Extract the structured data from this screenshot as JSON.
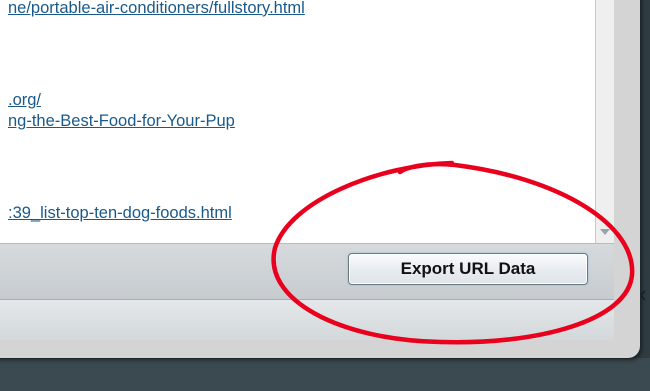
{
  "url_list": {
    "items": [
      {
        "text": "ne/portable-air-conditioners/fullstory.html"
      },
      {
        "text": ".org/"
      },
      {
        "text": "ng-the-Best-Food-for-Your-Pup"
      },
      {
        "text": ":39_list-top-ten-dog-foods.html"
      }
    ]
  },
  "toolbar": {
    "export_label": "Export URL Data"
  },
  "annotation": {
    "color": "#e8001c"
  },
  "edge": {
    "glyph": "×"
  }
}
